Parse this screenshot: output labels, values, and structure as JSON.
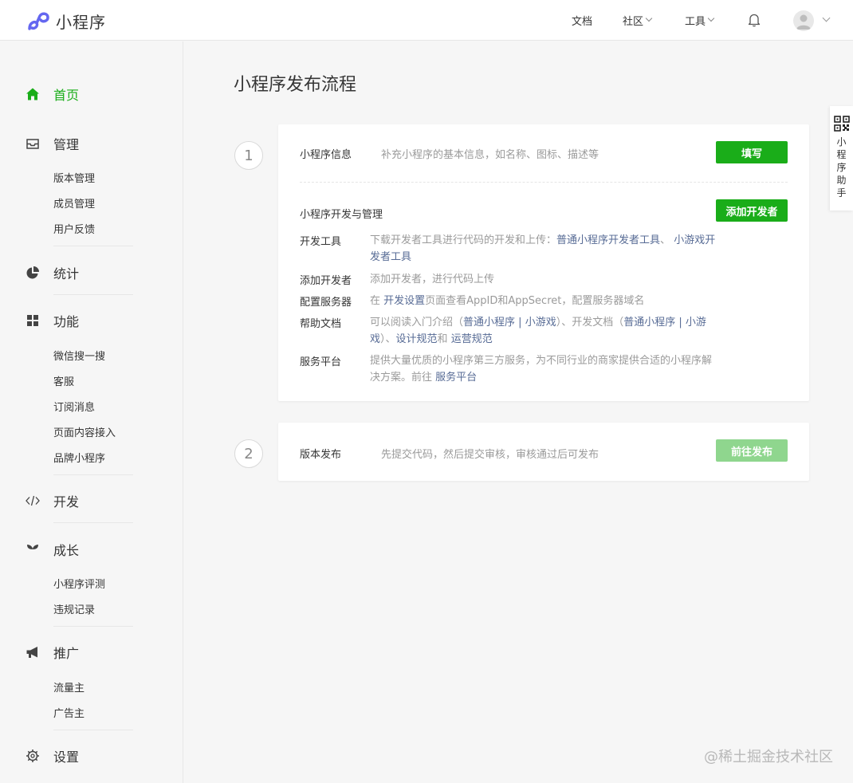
{
  "app": {
    "name": "小程序",
    "brand_color": "#6467f0"
  },
  "topnav": {
    "docs": "文档",
    "community": "社区",
    "tools": "工具"
  },
  "sidebar": {
    "home": "首页",
    "manage": "管理",
    "manage_items": [
      "版本管理",
      "成员管理",
      "用户反馈"
    ],
    "stats": "统计",
    "features": "功能",
    "features_items": [
      "微信搜一搜",
      "客服",
      "订阅消息",
      "页面内容接入",
      "品牌小程序"
    ],
    "develop": "开发",
    "growth": "成长",
    "growth_items": [
      "小程序评测",
      "违规记录"
    ],
    "promote": "推广",
    "promote_items": [
      "流量主",
      "广告主"
    ],
    "settings": "设置",
    "active_color": "#1aad19"
  },
  "main": {
    "title": "小程序发布流程",
    "step1": {
      "number": "1",
      "info_label": "小程序信息",
      "info_desc": "补充小程序的基本信息，如名称、图标、描述等",
      "fill_button": "填写",
      "dev_manage_label": "小程序开发与管理",
      "add_dev_button": "添加开发者",
      "rows": {
        "devtools": {
          "label": "开发工具",
          "text1": "下载开发者工具进行代码的开发和上传：",
          "link1": "普通小程序开发者工具",
          "sep": "、",
          "link2": "小游戏开发者工具"
        },
        "add_developer": {
          "label": "添加开发者",
          "text": "添加开发者，进行代码上传"
        },
        "server": {
          "label": "配置服务器",
          "text1": "在 ",
          "link": "开发设置",
          "text2": "页面查看AppID和AppSecret，配置服务器域名"
        },
        "help": {
          "label": "帮助文档",
          "text1": "可以阅读入门介绍（",
          "link1": "普通小程序",
          "bar1": " | ",
          "link2": "小游戏",
          "text2": "）、开发文档（",
          "link3": "普通小程序",
          "bar2": " | ",
          "link4": "小游戏",
          "text3": "）、",
          "link5": "设计规范",
          "text4": "和 ",
          "link6": "运营规范"
        },
        "service": {
          "label": "服务平台",
          "text1": "提供大量优质的小程序第三方服务，为不同行业的商家提供合适的小程序解决方案。前往 ",
          "link": "服务平台"
        }
      }
    },
    "step2": {
      "number": "2",
      "label": "版本发布",
      "desc": "先提交代码，然后提交审核，审核通过后可发布",
      "button": "前往发布"
    }
  },
  "helper": {
    "text": "小程序助手"
  },
  "watermark": "@稀土掘金技术社区"
}
